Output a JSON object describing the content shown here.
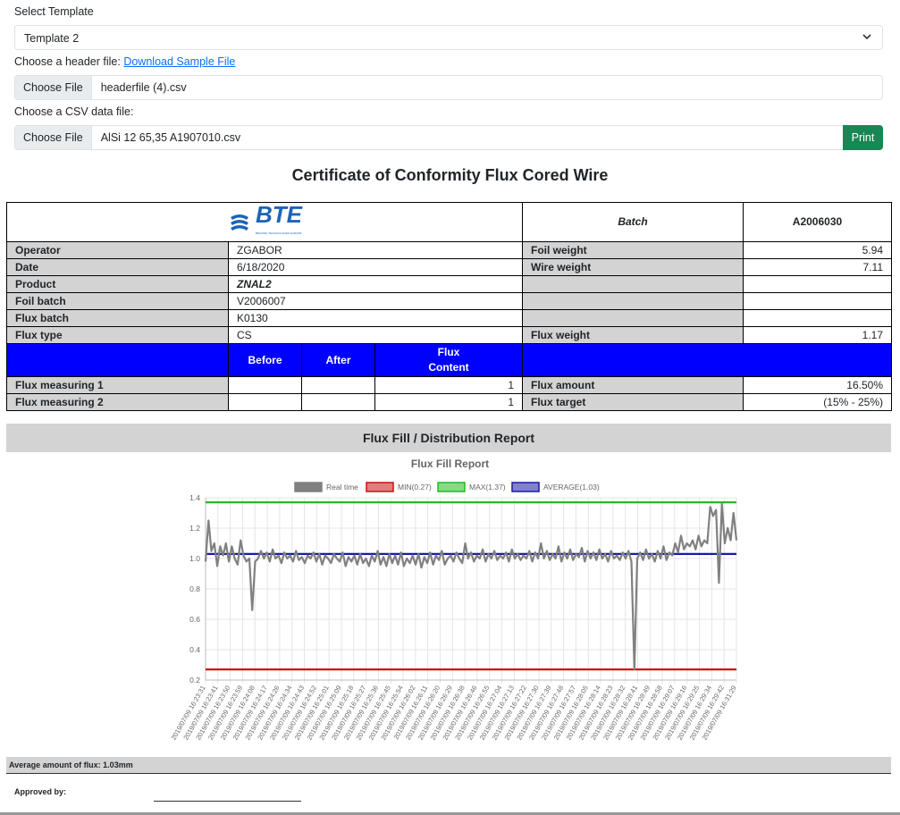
{
  "form": {
    "template_label": "Select Template",
    "template_value": "Template 2",
    "header_label": "Choose a header file:",
    "download_link": "Download Sample File",
    "choose_file": "Choose File",
    "header_filename": "headerfile (4).csv",
    "csv_label": "Choose a CSV data file:",
    "csv_filename": "AlSi 12 65,35 A1907010.csv",
    "print_label": "Print"
  },
  "certificate": {
    "title": "Certificate of Conformity Flux Cored Wire",
    "logo_text": "BTE",
    "logo_sub": "BRAZING TECHNOLOGIES EUROPE",
    "batch_label": "Batch",
    "batch_value": "A2006030",
    "operator_label": "Operator",
    "operator_value": "ZGABOR",
    "date_label": "Date",
    "date_value": "6/18/2020",
    "product_label": "Product",
    "product_value": "ZNAL2",
    "foil_batch_label": "Foil batch",
    "foil_batch_value": "V2006007",
    "flux_batch_label": "Flux batch",
    "flux_batch_value": "K0130",
    "flux_type_label": "Flux type",
    "flux_type_value": "CS",
    "foil_weight_label": "Foil weight",
    "foil_weight_value": "5.94",
    "wire_weight_label": "Wire weight",
    "wire_weight_value": "7.11",
    "flux_weight_label": "Flux weight",
    "flux_weight_value": "1.17",
    "before_label": "Before",
    "after_label": "After",
    "flux_content_label_1": "Flux",
    "flux_content_label_2": "Content",
    "flux_meas1_label": "Flux measuring 1",
    "flux_meas1_value": "1",
    "flux_meas2_label": "Flux measuring 2",
    "flux_meas2_value": "1",
    "flux_amount_label": "Flux amount",
    "flux_amount_value": "16.50%",
    "flux_target_label": "Flux target",
    "flux_target_value": "(15% - 25%)"
  },
  "report": {
    "header": "Flux Fill / Distribution Report",
    "average_text": "Average amount of flux: 1.03mm",
    "approved_label": "Approved by:"
  },
  "colors": {
    "primary_blue": "#0000ff",
    "print_green": "#198754",
    "series_realtime": "#808080",
    "series_min": "#cc1111",
    "series_max": "#22bb22",
    "series_avg": "#1a1aa6"
  },
  "chart_data": {
    "type": "line",
    "title": "Flux Fill Report",
    "legend_position": "top",
    "legend": [
      {
        "name": "Real time",
        "color": "#808080"
      },
      {
        "name": "MIN(0.27)",
        "color": "#cc1111"
      },
      {
        "name": "MAX(1.37)",
        "color": "#22bb22"
      },
      {
        "name": "AVERAGE(1.03)",
        "color": "#1a1aa6"
      }
    ],
    "ylim": [
      0.2,
      1.4
    ],
    "yticks": [
      1.4,
      1.2,
      1.0,
      0.8,
      0.6,
      0.4,
      0.2
    ],
    "grid": true,
    "x_tick_labels": [
      "2019/07/09 16:23:31",
      "2019/07/09 16:23:41",
      "2019/07/09 16:23:50",
      "2019/07/09 16:23:59",
      "2019/07/09 16:24:08",
      "2019/07/09 16:24:17",
      "2019/07/09 16:24:26",
      "2019/07/09 16:24:34",
      "2019/07/09 16:24:43",
      "2019/07/09 16:24:52",
      "2019/07/09 16:25:01",
      "2019/07/09 16:25:09",
      "2019/07/09 16:25:18",
      "2019/07/09 16:25:27",
      "2019/07/09 16:25:36",
      "2019/07/09 16:25:45",
      "2019/07/09 16:25:54",
      "2019/07/09 16:26:02",
      "2019/07/09 16:26:11",
      "2019/07/09 16:26:20",
      "2019/07/09 16:26:29",
      "2019/07/09 16:26:38",
      "2019/07/09 16:26:46",
      "2019/07/09 16:26:55",
      "2019/07/09 16:27:04",
      "2019/07/09 16:27:13",
      "2019/07/09 16:27:22",
      "2019/07/09 16:27:30",
      "2019/07/09 16:27:39",
      "2019/07/09 16:27:48",
      "2019/07/09 16:27:57",
      "2019/07/09 16:28:05",
      "2019/07/09 16:28:14",
      "2019/07/09 16:28:23",
      "2019/07/09 16:28:32",
      "2019/07/09 16:28:41",
      "2019/07/09 16:28:49",
      "2019/07/09 16:28:58",
      "2019/07/09 16:29:07",
      "2019/07/09 16:29:16",
      "2019/07/09 16:29:25",
      "2019/07/09 16:29:34",
      "2019/07/09 16:29:42",
      "2019/07/09 16:31:29"
    ],
    "series": [
      {
        "name": "Real time",
        "values": [
          0.98,
          1.25,
          1.05,
          1.1,
          0.95,
          1.08,
          1.02,
          1.1,
          0.98,
          1.08,
          1.0,
          0.96,
          1.12,
          1.02,
          0.98,
          1.0,
          0.66,
          0.98,
          1.0,
          1.05,
          1.0,
          1.04,
          0.98,
          1.06,
          1.0,
          1.02,
          0.97,
          1.04,
          1.0,
          1.02,
          0.98,
          1.05,
          0.99,
          1.01,
          0.97,
          1.02,
          1.0,
          1.04,
          0.98,
          1.03,
          0.96,
          1.02,
          1.0,
          0.97,
          1.03,
          1.0,
          0.98,
          1.04,
          0.95,
          1.01,
          0.98,
          1.02,
          0.96,
          1.03,
          0.97,
          1.0,
          0.95,
          1.02,
          0.98,
          1.05,
          0.96,
          1.01,
          0.95,
          1.03,
          0.97,
          1.02,
          0.96,
          1.04,
          0.95,
          1.0,
          0.97,
          1.02,
          0.96,
          1.03,
          0.94,
          1.01,
          0.97,
          1.04,
          0.96,
          1.02,
          0.99,
          1.05,
          0.96,
          1.0,
          1.02,
          0.98,
          1.04,
          1.0,
          0.97,
          1.1,
          1.0,
          1.04,
          0.98,
          1.02,
          1.0,
          1.06,
          0.98,
          1.03,
          1.0,
          1.05,
          0.99,
          1.02,
          1.0,
          1.04,
          0.98,
          1.06,
          1.0,
          1.03,
          0.99,
          1.02,
          1.0,
          1.05,
          0.98,
          1.04,
          1.0,
          1.1,
          1.0,
          1.05,
          0.99,
          1.03,
          1.0,
          1.08,
          0.98,
          1.04,
          1.0,
          1.06,
          0.99,
          1.03,
          1.01,
          1.07,
          0.98,
          1.05,
          1.0,
          1.04,
          0.99,
          1.06,
          1.0,
          1.03,
          0.98,
          1.05,
          1.0,
          1.02,
          0.99,
          1.04,
          1.0,
          1.05,
          0.98,
          0.27,
          1.0,
          1.04,
          0.99,
          1.06,
          1.0,
          1.03,
          0.98,
          1.05,
          1.0,
          1.08,
          0.99,
          1.04,
          1.02,
          1.1,
          1.04,
          1.15,
          1.06,
          1.1,
          1.08,
          1.12,
          1.06,
          1.15,
          1.08,
          1.12,
          1.1,
          1.34,
          1.28,
          1.32,
          0.84,
          1.36,
          1.1,
          1.2,
          1.12,
          1.3,
          1.12
        ]
      },
      {
        "name": "MIN(0.27)",
        "value": 0.27
      },
      {
        "name": "MAX(1.37)",
        "value": 1.37
      },
      {
        "name": "AVERAGE(1.03)",
        "value": 1.03
      }
    ]
  }
}
